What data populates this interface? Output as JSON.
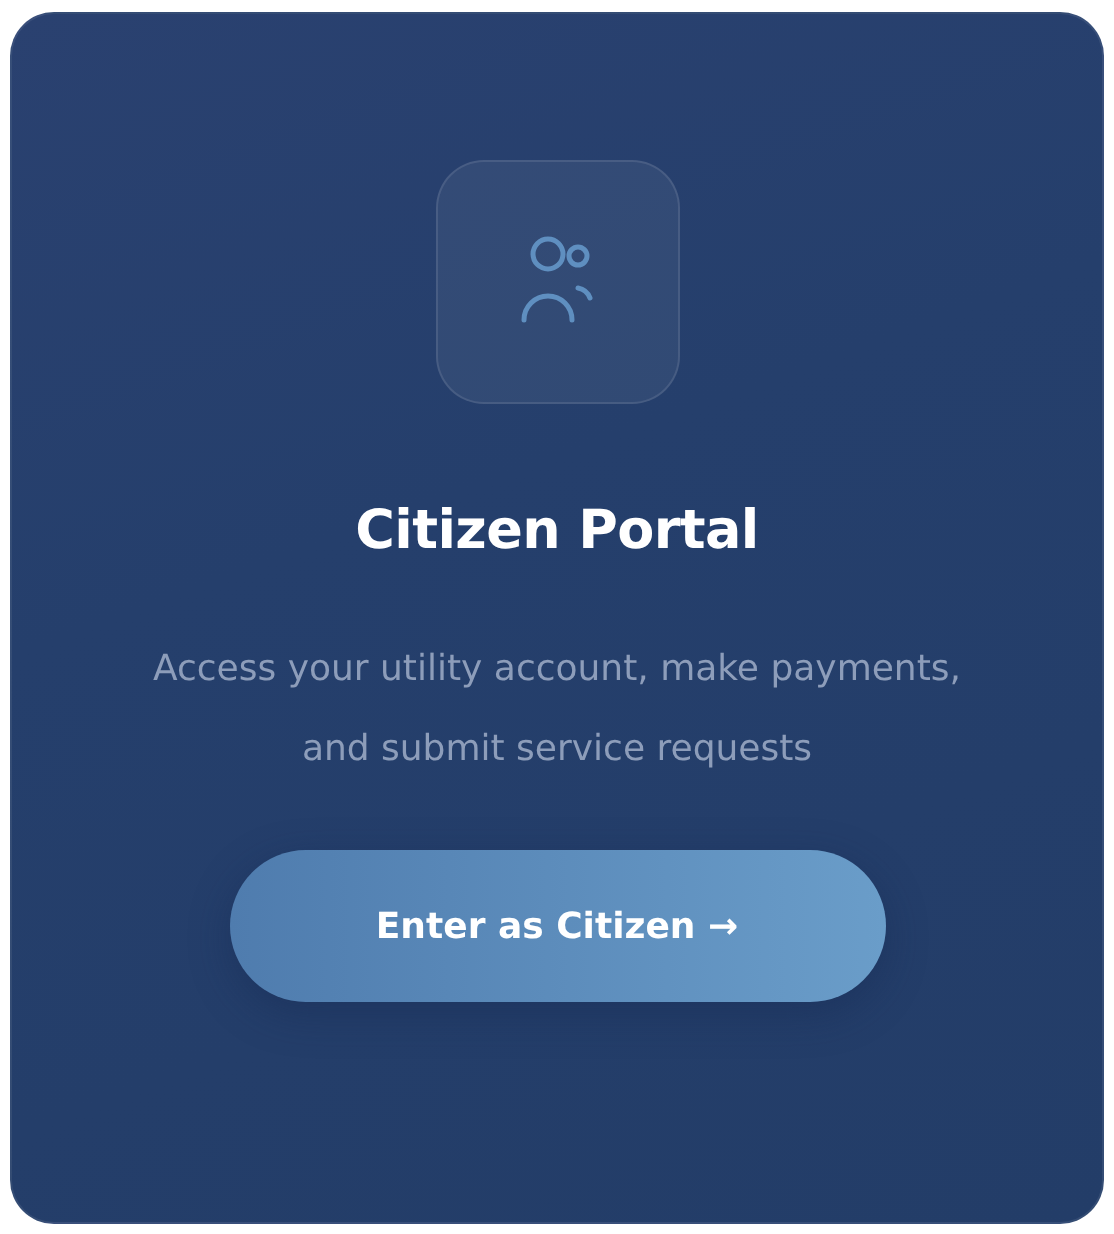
{
  "card": {
    "title": "Citizen Portal",
    "description": "Access your utility account, make payments, and submit service requests",
    "button": {
      "label": "Enter as Citizen →"
    }
  }
}
